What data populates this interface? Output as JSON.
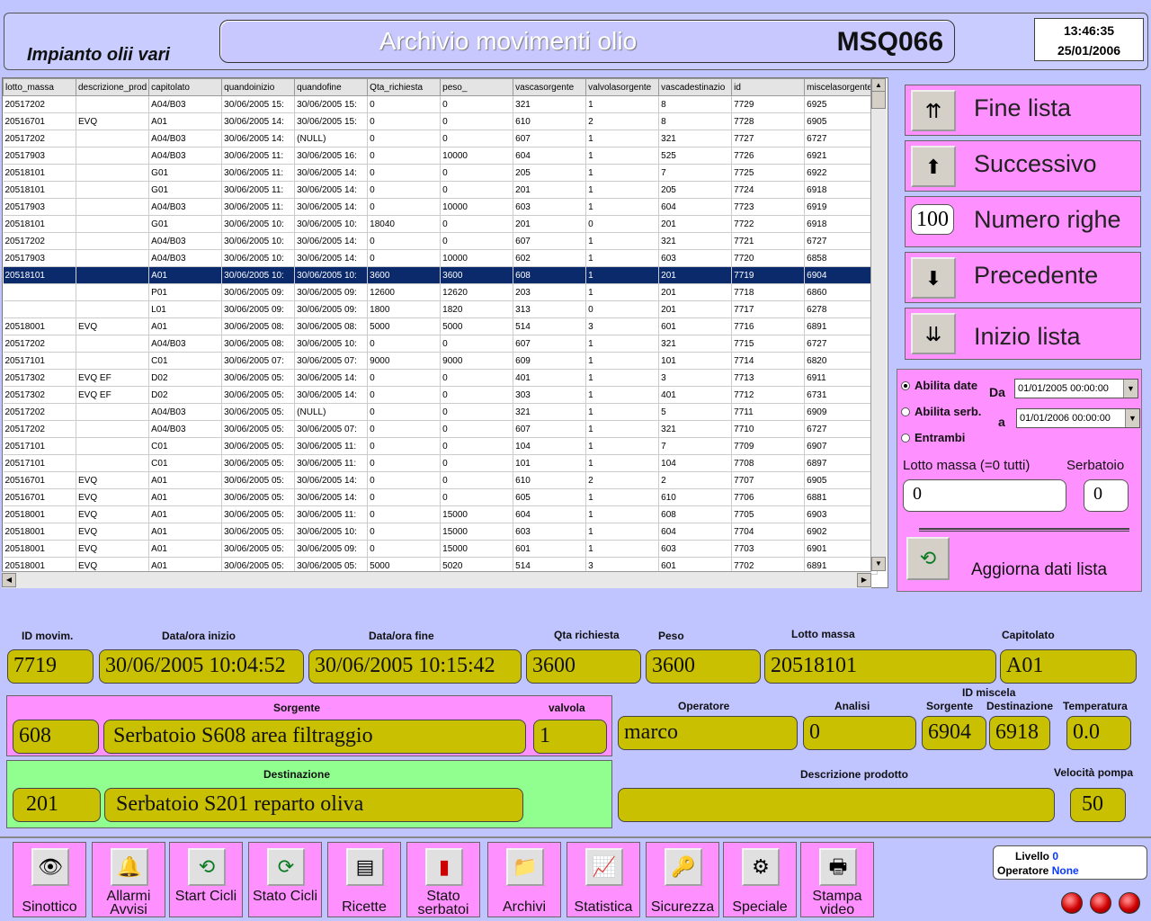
{
  "header": {
    "plant": "Impianto olii vari",
    "title": "Archivio movimenti olio",
    "code": "MSQ066",
    "time": "13:46:35",
    "date": "25/01/2006"
  },
  "grid": {
    "columns": [
      "lotto_massa",
      "descrizione_prod",
      "capitolato",
      "quandoinizio",
      "quandofine",
      "Qta_richiesta",
      "peso_",
      "vascasorgente",
      "valvolasorgente",
      "vascadestinazio",
      "id",
      "miscelasorgente"
    ],
    "rows": [
      [
        "20517202",
        "",
        "A04/B03",
        "30/06/2005 15:",
        "30/06/2005 15:",
        "0",
        "0",
        "321",
        "1",
        "8",
        "7729",
        "6925"
      ],
      [
        "20516701",
        "EVQ",
        "A01",
        "30/06/2005 14:",
        "30/06/2005 15:",
        "0",
        "0",
        "610",
        "2",
        "8",
        "7728",
        "6905"
      ],
      [
        "20517202",
        "",
        "A04/B03",
        "30/06/2005 14:",
        "(NULL)",
        "0",
        "0",
        "607",
        "1",
        "321",
        "7727",
        "6727"
      ],
      [
        "20517903",
        "",
        "A04/B03",
        "30/06/2005 11:",
        "30/06/2005 16:",
        "0",
        "10000",
        "604",
        "1",
        "525",
        "7726",
        "6921"
      ],
      [
        "20518101",
        "",
        "G01",
        "30/06/2005 11:",
        "30/06/2005 14:",
        "0",
        "0",
        "205",
        "1",
        "7",
        "7725",
        "6922"
      ],
      [
        "20518101",
        "",
        "G01",
        "30/06/2005 11:",
        "30/06/2005 14:",
        "0",
        "0",
        "201",
        "1",
        "205",
        "7724",
        "6918"
      ],
      [
        "20517903",
        "",
        "A04/B03",
        "30/06/2005 11:",
        "30/06/2005 14:",
        "0",
        "10000",
        "603",
        "1",
        "604",
        "7723",
        "6919"
      ],
      [
        "20518101",
        "",
        "G01",
        "30/06/2005 10:",
        "30/06/2005 10:",
        "18040",
        "0",
        "201",
        "0",
        "201",
        "7722",
        "6918"
      ],
      [
        "20517202",
        "",
        "A04/B03",
        "30/06/2005 10:",
        "30/06/2005 14:",
        "0",
        "0",
        "607",
        "1",
        "321",
        "7721",
        "6727"
      ],
      [
        "20517903",
        "",
        "A04/B03",
        "30/06/2005 10:",
        "30/06/2005 14:",
        "0",
        "10000",
        "602",
        "1",
        "603",
        "7720",
        "6858"
      ],
      [
        "20518101",
        "",
        "A01",
        "30/06/2005 10:",
        "30/06/2005 10:",
        "3600",
        "3600",
        "608",
        "1",
        "201",
        "7719",
        "6904"
      ],
      [
        "",
        "",
        "P01",
        "30/06/2005 09:",
        "30/06/2005 09:",
        "12600",
        "12620",
        "203",
        "1",
        "201",
        "7718",
        "6860"
      ],
      [
        "",
        "",
        "L01",
        "30/06/2005 09:",
        "30/06/2005 09:",
        "1800",
        "1820",
        "313",
        "0",
        "201",
        "7717",
        "6278"
      ],
      [
        "20518001",
        "EVQ",
        "A01",
        "30/06/2005 08:",
        "30/06/2005 08:",
        "5000",
        "5000",
        "514",
        "3",
        "601",
        "7716",
        "6891"
      ],
      [
        "20517202",
        "",
        "A04/B03",
        "30/06/2005 08:",
        "30/06/2005 10:",
        "0",
        "0",
        "607",
        "1",
        "321",
        "7715",
        "6727"
      ],
      [
        "20517101",
        "",
        "C01",
        "30/06/2005 07:",
        "30/06/2005 07:",
        "9000",
        "9000",
        "609",
        "1",
        "101",
        "7714",
        "6820"
      ],
      [
        "20517302",
        "EVQ EF",
        "D02",
        "30/06/2005 05:",
        "30/06/2005 14:",
        "0",
        "0",
        "401",
        "1",
        "3",
        "7713",
        "6911"
      ],
      [
        "20517302",
        "EVQ EF",
        "D02",
        "30/06/2005 05:",
        "30/06/2005 14:",
        "0",
        "0",
        "303",
        "1",
        "401",
        "7712",
        "6731"
      ],
      [
        "20517202",
        "",
        "A04/B03",
        "30/06/2005 05:",
        "(NULL)",
        "0",
        "0",
        "321",
        "1",
        "5",
        "7711",
        "6909"
      ],
      [
        "20517202",
        "",
        "A04/B03",
        "30/06/2005 05:",
        "30/06/2005 07:",
        "0",
        "0",
        "607",
        "1",
        "321",
        "7710",
        "6727"
      ],
      [
        "20517101",
        "",
        "C01",
        "30/06/2005 05:",
        "30/06/2005 11:",
        "0",
        "0",
        "104",
        "1",
        "7",
        "7709",
        "6907"
      ],
      [
        "20517101",
        "",
        "C01",
        "30/06/2005 05:",
        "30/06/2005 11:",
        "0",
        "0",
        "101",
        "1",
        "104",
        "7708",
        "6897"
      ],
      [
        "20516701",
        "EVQ",
        "A01",
        "30/06/2005 05:",
        "30/06/2005 14:",
        "0",
        "0",
        "610",
        "2",
        "2",
        "7707",
        "6905"
      ],
      [
        "20516701",
        "EVQ",
        "A01",
        "30/06/2005 05:",
        "30/06/2005 14:",
        "0",
        "0",
        "605",
        "1",
        "610",
        "7706",
        "6881"
      ],
      [
        "20518001",
        "EVQ",
        "A01",
        "30/06/2005 05:",
        "30/06/2005 11:",
        "0",
        "15000",
        "604",
        "1",
        "608",
        "7705",
        "6903"
      ],
      [
        "20518001",
        "EVQ",
        "A01",
        "30/06/2005 05:",
        "30/06/2005 10:",
        "0",
        "15000",
        "603",
        "1",
        "604",
        "7704",
        "6902"
      ],
      [
        "20518001",
        "EVQ",
        "A01",
        "30/06/2005 05:",
        "30/06/2005 09:",
        "0",
        "15000",
        "601",
        "1",
        "603",
        "7703",
        "6901"
      ],
      [
        "20518001",
        "EVQ",
        "A01",
        "30/06/2005 05:",
        "30/06/2005 05:",
        "5000",
        "5020",
        "514",
        "3",
        "601",
        "7702",
        "6891"
      ]
    ],
    "selected_row": 10
  },
  "nav": {
    "fine_lista": "Fine lista",
    "successivo": "Successivo",
    "numero_righe": "Numero righe",
    "numero_righe_value": "100",
    "precedente": "Precedente",
    "inizio_lista": "Inizio lista"
  },
  "filter": {
    "abilita_date": "Abilita date",
    "abilita_serb": "Abilita serb.",
    "entrambi": "Entrambi",
    "da_label": "Da",
    "a_label": "a",
    "da_value": "01/01/2005 00:00:00",
    "a_value": "01/01/2006 00:00:00",
    "lotto_label": "Lotto massa (=0 tutti)",
    "serbatoio_label": "Serbatoio",
    "lotto_value": "0",
    "serbatoio_value": "0",
    "aggiorna": "Aggiorna dati lista"
  },
  "detail": {
    "id_label": "ID movim.",
    "id": "7719",
    "inizio_label": "Data/ora inizio",
    "inizio": "30/06/2005 10:04:52",
    "fine_label": "Data/ora fine",
    "fine": "30/06/2005 10:15:42",
    "qta_label": "Qta richiesta",
    "qta": "3600",
    "peso_label": "Peso",
    "peso": "3600",
    "lotto_label": "Lotto massa",
    "lotto": "20518101",
    "capitolato_label": "Capitolato",
    "capitolato": "A01",
    "sorgente_label": "Sorgente",
    "sorgente_num": "608",
    "sorgente_desc": "Serbatoio S608 area filtraggio",
    "valvola_label": "valvola",
    "valvola": "1",
    "destinazione_label": "Destinazione",
    "dest_num": "201",
    "dest_desc": "Serbatoio S201 reparto oliva",
    "operatore_label": "Operatore",
    "operatore": "marco",
    "analisi_label": "Analisi",
    "analisi": "0",
    "idmiscela_label": "ID miscela",
    "mix_sorg_label": "Sorgente",
    "mix_sorg": "6904",
    "mix_dest_label": "Destinazione",
    "mix_dest": "6918",
    "temp_label": "Temperatura",
    "temp": "0.0",
    "descprod_label": "Descrizione prodotto",
    "descprod": "",
    "vel_label": "Velocità pompa",
    "vel": "50"
  },
  "toolbar": {
    "sinottico": "Sinottico",
    "allarmi": "Allarmi Avvisi",
    "start": "Start Cicli",
    "stato_cicli": "Stato Cicli",
    "ricette": "Ricette",
    "stato_serbatoi": "Stato serbatoi",
    "archivi": "Archivi",
    "statistica": "Statistica",
    "sicurezza": "Sicurezza",
    "speciale": "Speciale",
    "stampa": "Stampa video"
  },
  "status": {
    "livello_label": "Livello",
    "livello": "0",
    "operatore_label": "Operatore",
    "operatore": "None"
  },
  "colors": {
    "background": "#c0c4ff",
    "pink_panel": "#ff90ff",
    "green_panel": "#90ff90",
    "field": "#c8c000",
    "selected_row": "#0a2a6c"
  }
}
